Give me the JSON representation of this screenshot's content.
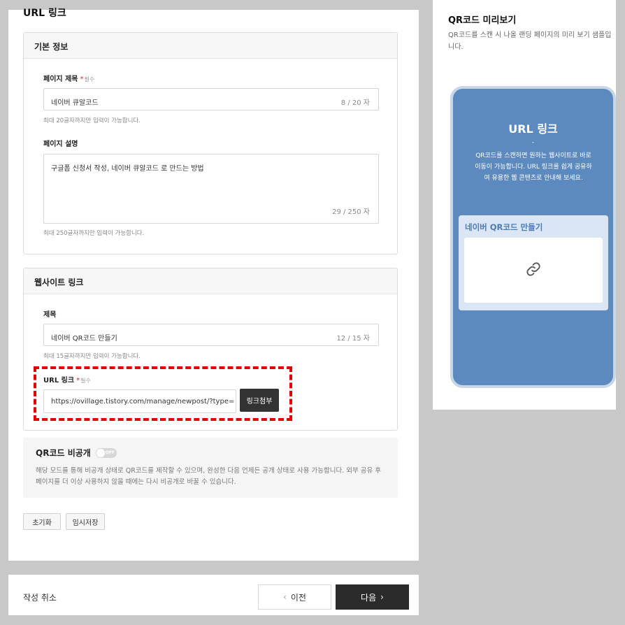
{
  "page": {
    "title": "URL 링크"
  },
  "basic": {
    "header": "기본 정보",
    "page_title_label": "페이지 제목",
    "required_mark": "*",
    "required_text": "필수",
    "page_title_value": "네이버 큐알코드",
    "page_title_count": "8 / 20 자",
    "page_title_hint": "최대 20글자까지만 입력이 가능합니다.",
    "desc_label": "페이지 설명",
    "desc_value": "구글폼 신청서 작성, 네이버 큐알코드 로 만드는 방법",
    "desc_count": "29 / 250 자",
    "desc_hint": "최대 250글자까지만 입력이 가능합니다."
  },
  "website": {
    "header": "웹사이트 링크",
    "title_label": "제목",
    "title_value": "네이버 QR코드 만들기",
    "title_count": "12 / 15 자",
    "title_hint": "최대 15글자까지만 입력이 가능합니다.",
    "url_label": "URL 링크",
    "url_value": "https://ovillage.tistory.com/manage/newpost/?type=post&re",
    "attach_button": "링크첨부"
  },
  "qr_private": {
    "title": "QR코드 비공개",
    "toggle_text": "OFF",
    "description": "해당 모드를 통해 비공개 상태로 QR코드를 제작할 수 있으며, 완성한 다음 언제든 공개 상태로 사용 가능합니다. 외부 공유 후 페이지를 더 이상 사용하지 않을 때에는 다시 비공개로 바꿀 수 있습니다."
  },
  "actions": {
    "reset": "초기화",
    "temp_save": "임시저장"
  },
  "footer": {
    "cancel": "작성 취소",
    "prev": "이전",
    "next": "다음",
    "prev_icon": "‹",
    "next_icon": "›"
  },
  "preview": {
    "title": "QR코드 미리보기",
    "description": "QR코드를 스캔 시 나올 랜딩 페이지의 미리 보기 샘플입니다.",
    "phone_title": "URL 링크",
    "phone_dash": "-",
    "phone_desc": "QR코드를 스캔하면 원하는 웹사이트로 바로 이동이 가능합니다. URL 링크를 쉽게 공유하여 유용한 웹 콘텐츠로 안내해 보세요.",
    "link_card_title": "네이버 QR코드 만들기",
    "link_icon": "link-icon"
  },
  "colors": {
    "required": "#e02020",
    "phone_bg": "#5c89be",
    "highlight_border": "#e30000",
    "next_button": "#2b2b2b"
  }
}
